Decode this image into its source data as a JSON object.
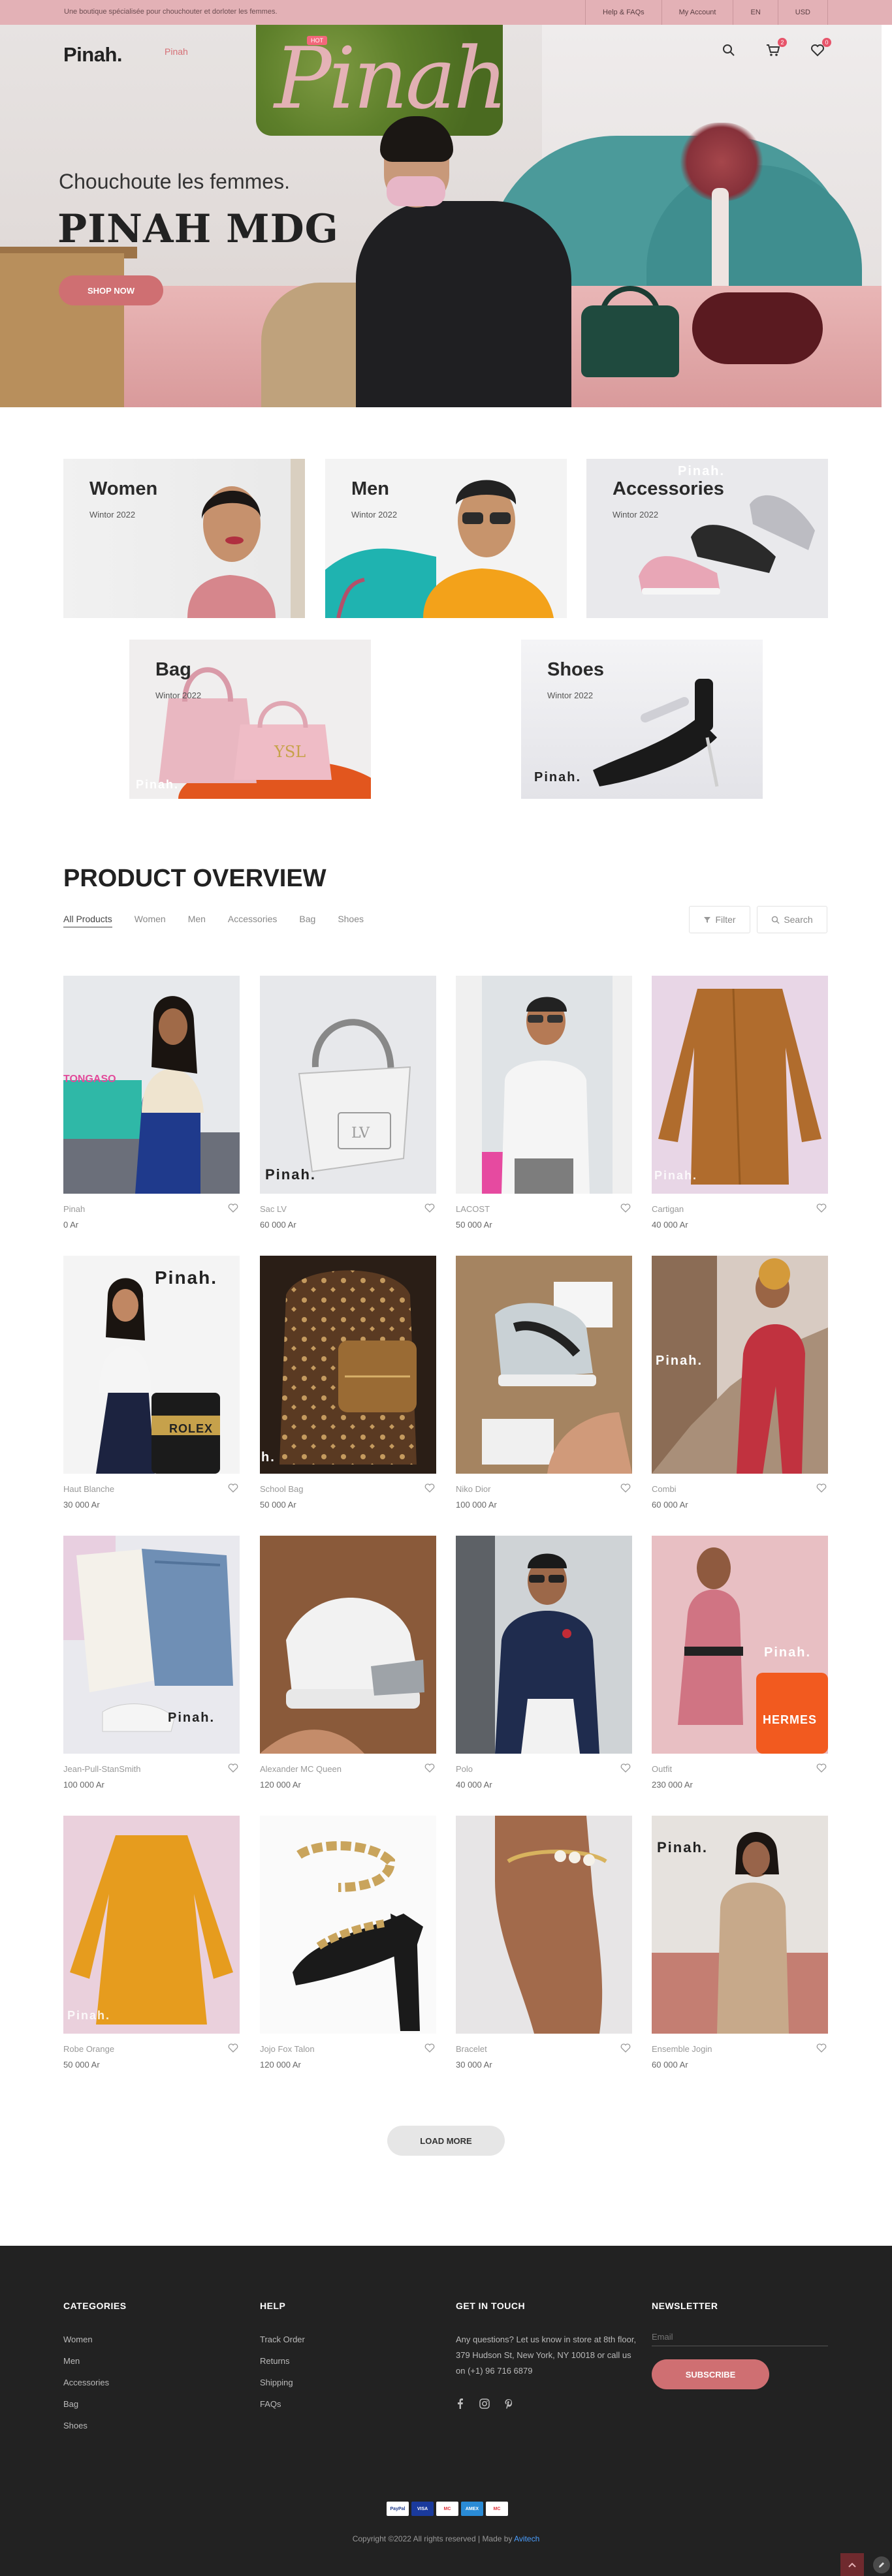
{
  "topbar": {
    "tagline": "Une boutique spécialisée pour chouchouter et dorloter les femmes.",
    "links": [
      "Help & FAQs",
      "My Account",
      "EN",
      "USD"
    ]
  },
  "header": {
    "logo": "Pinah.",
    "nav": [
      "Pinah",
      ""
    ],
    "hot_badge": "HOT",
    "cart_count": "2",
    "wishlist_count": "0"
  },
  "hero": {
    "subtitle": "Chouchoute les femmes.",
    "title": "PINAH MDG",
    "cta": "SHOP NOW"
  },
  "categories": [
    {
      "title": "Women",
      "sub": "Wintor 2022"
    },
    {
      "title": "Men",
      "sub": "Wintor 2022"
    },
    {
      "title": "Accessories",
      "sub": "Wintor 2022"
    },
    {
      "title": "Bag",
      "sub": "Wintor 2022"
    },
    {
      "title": "Shoes",
      "sub": "Wintor 2022"
    }
  ],
  "brand_watermark": "Pinah.",
  "overview": {
    "title": "PRODUCT OVERVIEW",
    "filters": [
      "All Products",
      "Women",
      "Men",
      "Accessories",
      "Bag",
      "Shoes"
    ],
    "filter_label": "Filter",
    "search_label": "Search"
  },
  "products": [
    {
      "name": "Pinah",
      "price": "0 Ar"
    },
    {
      "name": "Sac LV",
      "price": "60 000 Ar"
    },
    {
      "name": "LACOST",
      "price": "50 000 Ar"
    },
    {
      "name": "Cartigan",
      "price": "40 000 Ar"
    },
    {
      "name": "Haut Blanche",
      "price": "30 000 Ar"
    },
    {
      "name": "School Bag",
      "price": "50 000 Ar"
    },
    {
      "name": "Niko Dior",
      "price": "100 000 Ar"
    },
    {
      "name": "Combi",
      "price": "60 000 Ar"
    },
    {
      "name": "Jean-Pull-StanSmith",
      "price": "100 000 Ar"
    },
    {
      "name": "Alexander MC Queen",
      "price": "120 000 Ar"
    },
    {
      "name": "Polo",
      "price": "40 000 Ar"
    },
    {
      "name": "Outfit",
      "price": "230 000 Ar"
    },
    {
      "name": "Robe Orange",
      "price": "50 000 Ar"
    },
    {
      "name": "Jojo Fox Talon",
      "price": "120 000 Ar"
    },
    {
      "name": "Bracelet",
      "price": "30 000 Ar"
    },
    {
      "name": "Ensemble Jogin",
      "price": "60 000 Ar"
    }
  ],
  "image_texts": {
    "tongasoa": "TONGASO",
    "rolex": "ROLEX",
    "hermes": "HERMES",
    "small_h": "h."
  },
  "load_more": "LOAD MORE",
  "footer": {
    "categories": {
      "title": "CATEGORIES",
      "items": [
        "Women",
        "Men",
        "Accessories",
        "Bag",
        "Shoes"
      ]
    },
    "help": {
      "title": "HELP",
      "items": [
        "Track Order",
        "Returns",
        "Shipping",
        "FAQs"
      ]
    },
    "contact": {
      "title": "GET IN TOUCH",
      "text": "Any questions? Let us know in store at 8th floor, 379 Hudson St, New York, NY 10018 or call us on (+1) 96 716 6879"
    },
    "newsletter": {
      "title": "NEWSLETTER",
      "placeholder": "Email",
      "button": "SUBSCRIBE"
    },
    "payments": [
      "PayPal",
      "VISA",
      "MC",
      "AMEX",
      "MC"
    ],
    "copyright": "Copyright ©2022 All rights reserved | Made by ",
    "copyright_link": "Avitech"
  },
  "colors": {
    "accent": "#cf6f72",
    "topbar": "#e3b1b6",
    "footer": "#222222"
  }
}
